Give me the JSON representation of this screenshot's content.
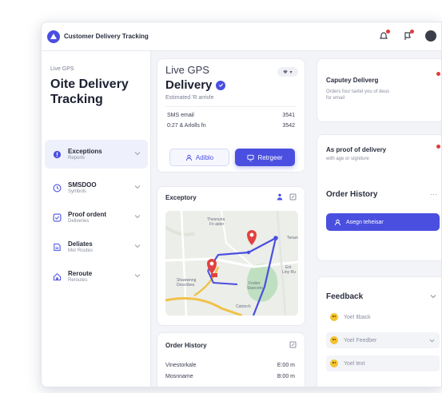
{
  "app": {
    "title": "Customer Delivery Tracking"
  },
  "sidebar": {
    "kicker": "Live GPS",
    "title": "Oite Delivery Tracking",
    "items": [
      {
        "label": "Exceptions",
        "sub": "Reports",
        "icon": "alert-circle-icon",
        "active": true
      },
      {
        "label": "SMSDOO",
        "sub": "Symbols",
        "icon": "clock-icon"
      },
      {
        "label": "Proof ordent",
        "sub": "Deliveries",
        "icon": "checkbox-icon"
      },
      {
        "label": "Deliates",
        "sub": "Mor Routes",
        "icon": "document-icon"
      },
      {
        "label": "Reroute",
        "sub": "Reroutes",
        "icon": "home-icon"
      }
    ]
  },
  "gps_card": {
    "kicker": "Live GPS",
    "title": "Delivery",
    "subtitle": "Estimated 'R arrivle",
    "chip": "▾",
    "rows": [
      {
        "label": "SMS email",
        "value": "3541"
      },
      {
        "label": "0:27 & Arlolls fn",
        "value": "3542"
      }
    ],
    "btn_outline": "Adiblo",
    "btn_solid": "Retrgeer"
  },
  "map_card": {
    "title": "Exceptory",
    "labels": [
      "Thesnuria\nFn alder",
      "Tenarv",
      "Fodorr\nStanceto",
      "Ent\nLiny Ru",
      "Shawwnng\nDescribes",
      "Catonch"
    ]
  },
  "order_history": {
    "title": "Order History",
    "rows": [
      {
        "label": "Vinestorkale",
        "value": "E:00 m"
      },
      {
        "label": "Mosnname",
        "value": "B:00 m"
      }
    ]
  },
  "right": {
    "card1": {
      "title": "Caputey Deliverg",
      "sub": "Orders four taxtel you of deus\nfor email"
    },
    "card2": {
      "title": "As proof of delivery",
      "sub": "with age or signiture",
      "history_title": "Order History",
      "more": "···",
      "assign_label": "Asegn teheisar"
    },
    "feedback": {
      "title": "Feedback",
      "rows": [
        "Yoel ltback",
        "Yoel Feedber",
        "Yoel text"
      ]
    }
  },
  "colors": {
    "accent": "#4a4fe0",
    "alert": "#e23b3b",
    "route_primary": "#4a4fe0",
    "route_secondary": "#f0c24a"
  }
}
